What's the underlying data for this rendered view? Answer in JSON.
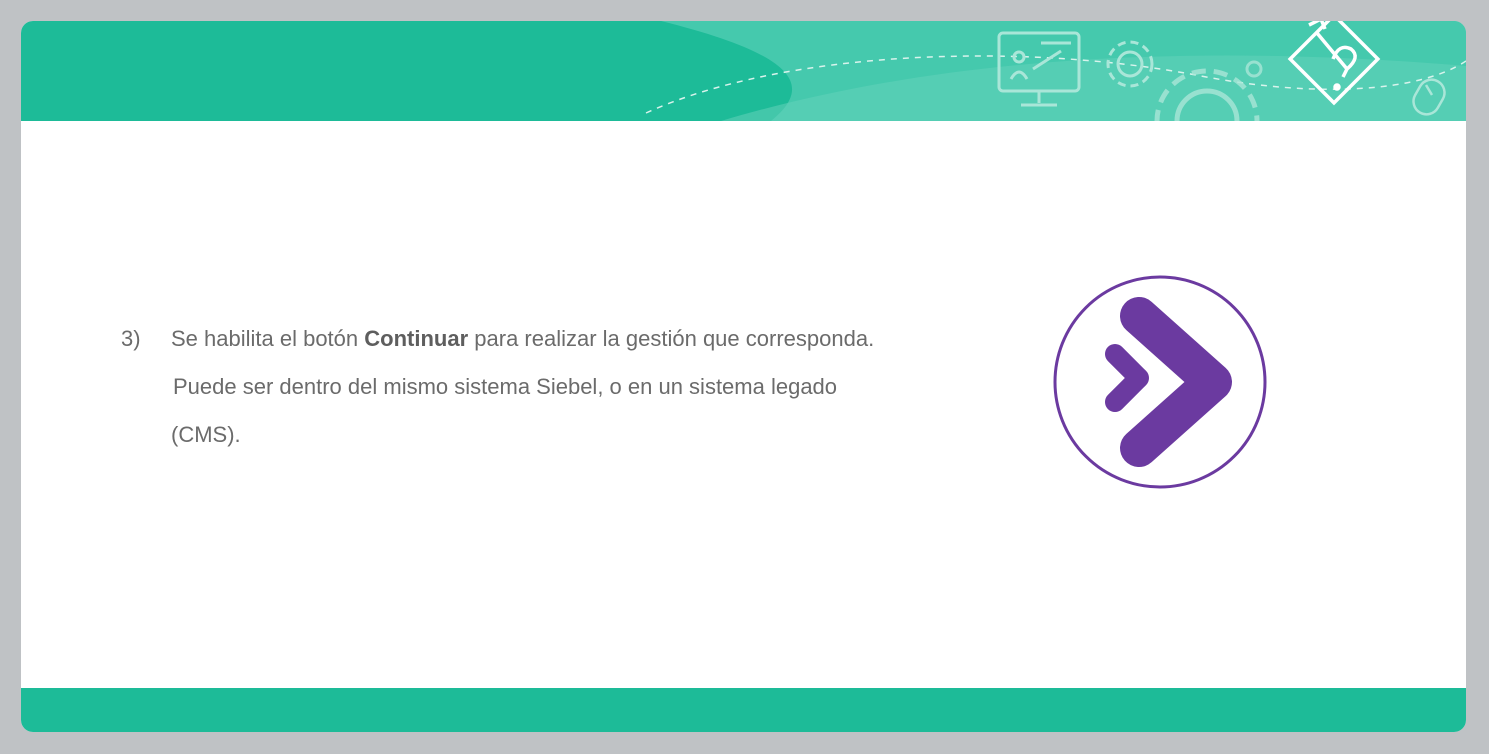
{
  "step": {
    "number": "3)",
    "line1_before": "Se habilita el botón ",
    "line1_bold": "Continuar",
    "line1_after": " para realizar la gestión que corresponda.",
    "line2": "Puede ser dentro del mismo sistema Siebel, o en un sistema legado",
    "line3": "(CMS)."
  },
  "icons": {
    "continue": "double-chevron-right-icon",
    "header_decorations": [
      "presentation-screen-icon",
      "gear-icon",
      "large-gear-icon",
      "pencil-question-icon",
      "mouse-icon"
    ]
  },
  "colors": {
    "header_green": "#1dbb98",
    "header_light_green": "#4ccbb0",
    "accent_purple": "#6b3aa0",
    "text_gray": "#6b6b6b",
    "frame_gray": "#bfc2c5"
  }
}
